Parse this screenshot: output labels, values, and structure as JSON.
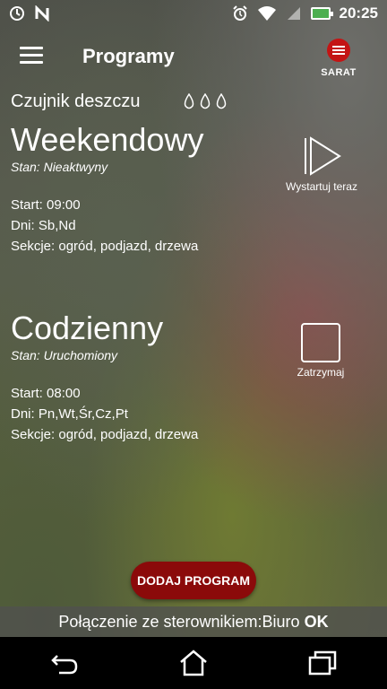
{
  "status_bar": {
    "time": "20:25",
    "icons": [
      "sync-icon",
      "n-icon",
      "alarm-icon",
      "wifi-icon",
      "signal-icon",
      "battery-charging-icon"
    ]
  },
  "app_bar": {
    "title": "Programy",
    "logo_text": "SARAT"
  },
  "sensor": {
    "label": "Czujnik deszczu",
    "icon": "rain-drops-icon"
  },
  "programs": [
    {
      "name": "Weekendowy",
      "state": "Stan: Nieaktwyny",
      "start": "Start: 09:00",
      "days": "Dni: Sb,Nd",
      "sections": "Sekcje: ogród, podjazd, drzewa",
      "action_label": "Wystartuj teraz",
      "action_icon": "play-icon"
    },
    {
      "name": "Codzienny",
      "state": "Stan: Uruchomiony",
      "start": "Start: 08:00",
      "days": "Dni: Pn,Wt,Śr,Cz,Pt",
      "sections": "Sekcje: ogród, podjazd, drzewa",
      "action_label": "Zatrzymaj",
      "action_icon": "stop-icon"
    }
  ],
  "add_button": {
    "label": "DODAJ PROGRAM"
  },
  "connection": {
    "text": "Połączenie ze sterownikiem:Biuro",
    "status": "OK"
  },
  "colors": {
    "accent": "#8b0a0a",
    "battery": "#4caf50"
  }
}
